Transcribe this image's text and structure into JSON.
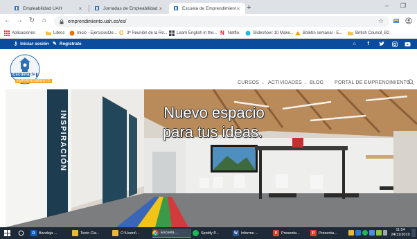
{
  "browser": {
    "tabs": [
      {
        "title": "Empleabilidad UAH",
        "active": false
      },
      {
        "title": "Jornadas de Empleabilidad",
        "active": false
      },
      {
        "title": "Escuela de Emprendimiento",
        "active": true
      }
    ],
    "new_tab_label": "+",
    "url": "emprendimiento.uah.es/es/",
    "bookmarks": [
      {
        "label": "Aplicaciones",
        "icon": "apps-grid-icon"
      },
      {
        "label": "Libros",
        "icon": "folder-icon"
      },
      {
        "label": "Inicio - EjerciciosDe...",
        "icon": "site-icon"
      },
      {
        "label": "3ª Reunión de la Re...",
        "icon": "google-icon"
      },
      {
        "label": "Learn English in the...",
        "icon": "site-icon"
      },
      {
        "label": "Netflix",
        "icon": "netflix-icon"
      },
      {
        "label": "Slideshow: 10 Make...",
        "icon": "site-icon"
      },
      {
        "label": "Boletín semanal - E...",
        "icon": "site-icon"
      },
      {
        "label": "British Council_B2",
        "icon": "folder-icon"
      }
    ]
  },
  "site": {
    "topbar": {
      "login_label": "Iniciar sesión",
      "register_label": "Regístrate",
      "social_icons": [
        "home-icon",
        "facebook-icon",
        "twitter-icon",
        "instagram-icon",
        "youtube-icon"
      ]
    },
    "logo": {
      "line1_a": "Escuela",
      "line1_b": "de",
      "line2": "EMPRENDIMIENTO"
    },
    "nav": [
      {
        "label": "CURSOS",
        "dropdown": true
      },
      {
        "label": "ACTIVIDADES",
        "dropdown": true
      },
      {
        "label": "BLOG",
        "dropdown": false
      },
      {
        "label": "PORTAL DE EMPRENDIMIENTO",
        "dropdown": false
      }
    ],
    "hero": {
      "line1": "Nuevo espacio",
      "line2": "para tus ideas.",
      "wall_text": "INSPIRACIÓN"
    }
  },
  "taskbar": {
    "items": [
      {
        "label": "Bandeja ...",
        "icon": "outlook-icon",
        "color": "#0a64c8"
      },
      {
        "label": "Texto Cla...",
        "icon": "folder-icon",
        "color": "#e8b739"
      },
      {
        "label": "C:\\Users\\...",
        "icon": "explorer-icon",
        "color": "#e8b739"
      },
      {
        "label": "Escuela ...",
        "icon": "chrome-icon",
        "color": "#34a853",
        "active": true
      },
      {
        "label": "Spotify P...",
        "icon": "spotify-icon",
        "color": "#1db954"
      },
      {
        "label": "Informe ...",
        "icon": "word-icon",
        "color": "#2b579a"
      },
      {
        "label": "Presenta...",
        "icon": "powerpoint-icon",
        "color": "#d24726"
      },
      {
        "label": "Presenta...",
        "icon": "powerpoint-icon",
        "color": "#d24726"
      }
    ],
    "clock_time": "11:54",
    "clock_date": "24/11/2019"
  },
  "colors": {
    "site_bar": "#0b4d9c",
    "logo_blue": "#2b6fb6",
    "logo_orange": "#f5a623",
    "taskbar": "#1f2a38"
  }
}
